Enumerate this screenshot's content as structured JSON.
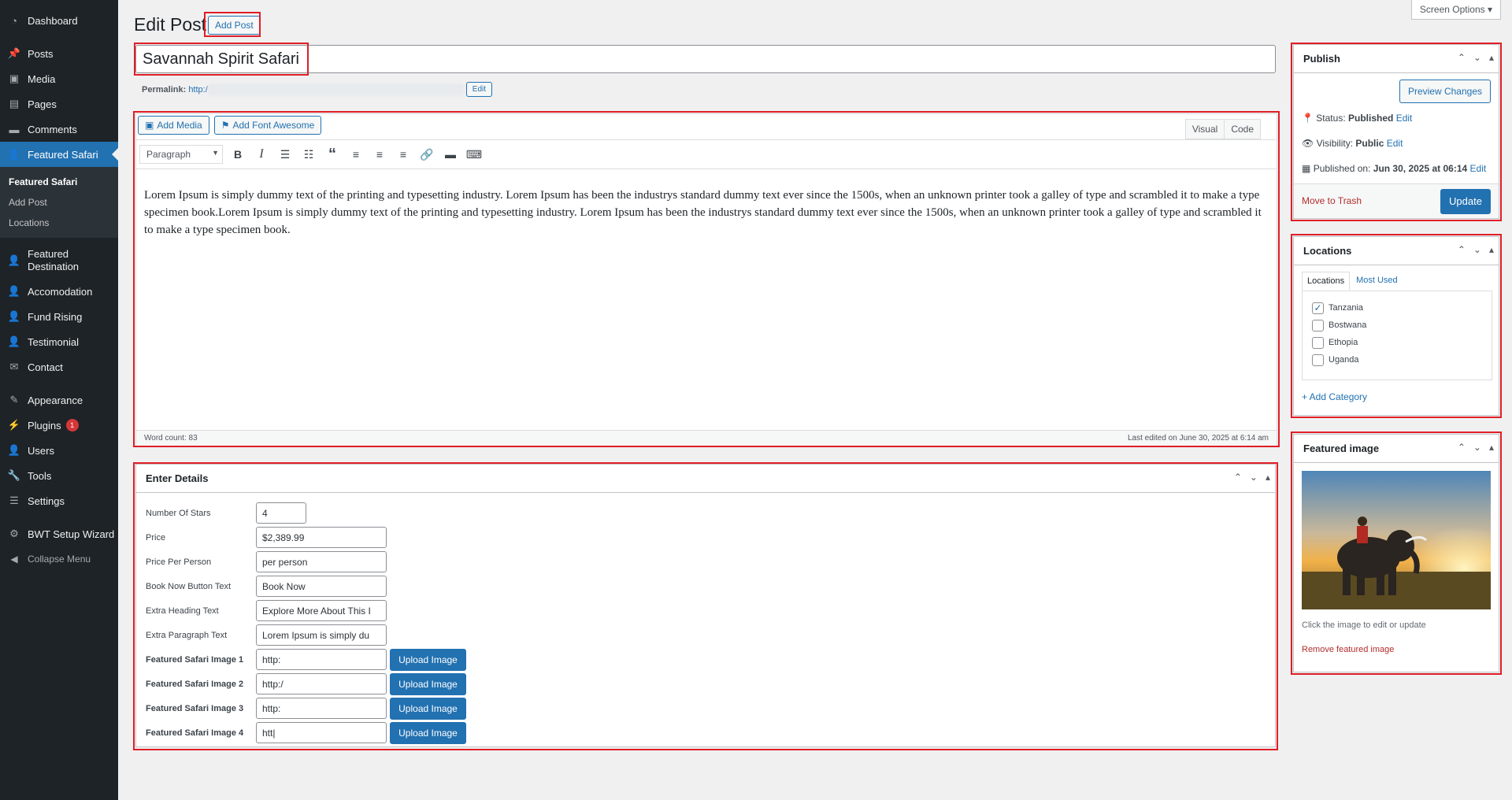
{
  "sidebar": {
    "items": [
      {
        "label": "Dashboard",
        "icon": "dashboard-icon"
      },
      {
        "label": "Posts",
        "icon": "pin-icon"
      },
      {
        "label": "Media",
        "icon": "media-icon"
      },
      {
        "label": "Pages",
        "icon": "pages-icon"
      },
      {
        "label": "Comments",
        "icon": "comments-icon"
      },
      {
        "label": "Featured Safari",
        "icon": "users-icon"
      },
      {
        "label": "Featured Destination",
        "icon": "users-icon"
      },
      {
        "label": "Accomodation",
        "icon": "users-icon"
      },
      {
        "label": "Fund Rising",
        "icon": "users-icon"
      },
      {
        "label": "Testimonial",
        "icon": "users-icon"
      },
      {
        "label": "Contact",
        "icon": "mail-icon"
      },
      {
        "label": "Appearance",
        "icon": "brush-icon"
      },
      {
        "label": "Plugins",
        "icon": "plugin-icon",
        "badge": "1"
      },
      {
        "label": "Users",
        "icon": "user-icon"
      },
      {
        "label": "Tools",
        "icon": "wrench-icon"
      },
      {
        "label": "Settings",
        "icon": "settings-icon"
      },
      {
        "label": "BWT Setup Wizard",
        "icon": "gear-icon"
      },
      {
        "label": "Collapse Menu",
        "icon": "collapse-icon"
      }
    ],
    "submenu": [
      "Featured Safari",
      "Add Post",
      "Locations"
    ]
  },
  "header": {
    "title": "Edit Post",
    "add_post": "Add Post",
    "screen_options": "Screen Options"
  },
  "post": {
    "title": "Savannah Spirit Safari",
    "permalink_label": "Permalink:",
    "permalink_value": "http:/",
    "edit_label": "Edit"
  },
  "editor": {
    "add_media": "Add Media",
    "add_font_awesome": "Add Font Awesome",
    "tab_visual": "Visual",
    "tab_code": "Code",
    "format": "Paragraph",
    "content": "Lorem Ipsum is simply dummy text of the printing and typesetting industry. Lorem Ipsum has been the industrys standard dummy text ever since the 1500s, when an unknown printer took a galley of type and scrambled it to make a type specimen book.Lorem Ipsum is simply dummy text of the printing and typesetting industry. Lorem Ipsum has been the industrys standard dummy text ever since the 1500s, when an unknown printer took a galley of type and scrambled it to make a type specimen book.",
    "word_count": "Word count: 83",
    "last_edited": "Last edited on June 30, 2025 at 6:14 am"
  },
  "details": {
    "title": "Enter Details",
    "stars_label": "Number Of Stars",
    "stars_value": "4",
    "price_label": "Price",
    "price_value": "$2,389.99",
    "ppp_label": "Price Per Person",
    "ppp_value": "per person",
    "book_label": "Book Now Button Text",
    "book_value": "Book Now",
    "heading_label": "Extra Heading Text",
    "heading_value": "Explore More About This I",
    "para_label": "Extra Paragraph Text",
    "para_value": "Lorem Ipsum is simply du",
    "img1_label": "Featured Safari Image 1",
    "img1_value": "http:",
    "img2_label": "Featured Safari Image 2",
    "img2_value": "http:/",
    "img3_label": "Featured Safari Image 3",
    "img3_value": "http:",
    "img4_label": "Featured Safari Image 4",
    "img4_value": "htt|",
    "upload": "Upload Image"
  },
  "publish": {
    "title": "Publish",
    "preview": "Preview Changes",
    "status_label": "Status:",
    "status_value": "Published",
    "visibility_label": "Visibility:",
    "visibility_value": "Public",
    "published_label": "Published on:",
    "published_value": "Jun 30, 2025 at 06:14",
    "edit": "Edit",
    "trash": "Move to Trash",
    "update": "Update"
  },
  "locations": {
    "title": "Locations",
    "tab_all": "Locations",
    "tab_used": "Most Used",
    "items": [
      {
        "label": "Tanzania",
        "checked": true
      },
      {
        "label": "Bostwana",
        "checked": false
      },
      {
        "label": "Ethopia",
        "checked": false
      },
      {
        "label": "Uganda",
        "checked": false
      }
    ],
    "add": "+ Add Category"
  },
  "featured_image": {
    "title": "Featured image",
    "hint": "Click the image to edit or update",
    "remove": "Remove featured image"
  }
}
